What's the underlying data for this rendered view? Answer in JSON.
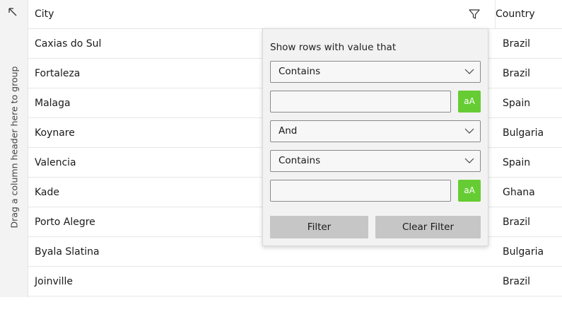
{
  "group_panel": {
    "text": "Drag a column header here to group",
    "corner_icon": "arrow-up-left-icon"
  },
  "columns": {
    "city": "City",
    "country": "Country",
    "filter_icon": "funnel-icon"
  },
  "rows": [
    {
      "city": "Caxias do Sul",
      "country": "Brazil"
    },
    {
      "city": "Fortaleza",
      "country": "Brazil"
    },
    {
      "city": "Malaga",
      "country": "Spain"
    },
    {
      "city": "Koynare",
      "country": "Bulgaria"
    },
    {
      "city": "Valencia",
      "country": "Spain"
    },
    {
      "city": "Kade",
      "country": "Ghana"
    },
    {
      "city": "Porto Alegre",
      "country": "Brazil"
    },
    {
      "city": "Byala Slatina",
      "country": "Bulgaria"
    },
    {
      "city": "Joinville",
      "country": "Brazil"
    }
  ],
  "filter_popup": {
    "title": "Show rows with value that",
    "operator1": "Contains",
    "value1": "",
    "logical_operator": "And",
    "operator2": "Contains",
    "value2": "",
    "case_sensitive_label": "aA",
    "filter_button": "Filter",
    "clear_button": "Clear Filter"
  },
  "colors": {
    "case_toggle": "#66cc33",
    "button_bg": "#c6c6c6",
    "popup_bg": "#f2f2f2",
    "group_panel_bg": "#f3f3f3"
  }
}
